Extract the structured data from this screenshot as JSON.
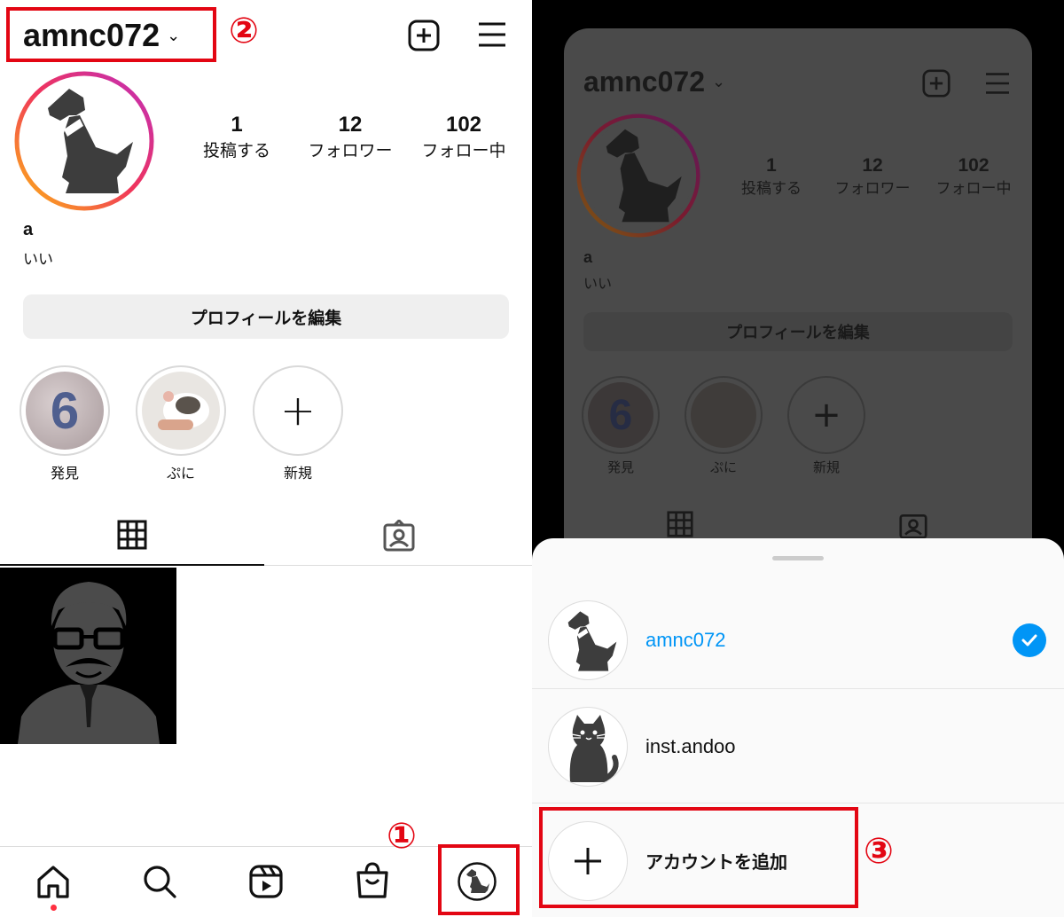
{
  "profile": {
    "username": "amnc072",
    "stats": [
      {
        "num": "1",
        "label": "投稿する"
      },
      {
        "num": "12",
        "label": "フォロワー"
      },
      {
        "num": "102",
        "label": "フォロー中"
      }
    ],
    "name": "a",
    "bio": "いい",
    "edit_label": "プロフィールを編集",
    "highlights": [
      {
        "label": "発見",
        "glyph": "6"
      },
      {
        "label": "ぷに",
        "glyph": ""
      },
      {
        "label": "新規",
        "glyph": "+"
      }
    ]
  },
  "annotations": {
    "one": "①",
    "two": "②",
    "three": "③"
  },
  "sheet": {
    "accounts": [
      {
        "name": "amnc072",
        "selected": true
      },
      {
        "name": "inst.andoo",
        "selected": false
      }
    ],
    "add_label": "アカウントを追加"
  },
  "colors": {
    "accent_blue": "#0095f6",
    "annotation_red": "#e30613",
    "notification_dot": "#ff3040"
  },
  "icons": [
    "chevron-down-icon",
    "new-post-icon",
    "menu-icon",
    "grid-icon",
    "tagged-icon",
    "home-icon",
    "search-icon",
    "reels-icon",
    "shop-icon",
    "check-icon",
    "plus-icon"
  ]
}
